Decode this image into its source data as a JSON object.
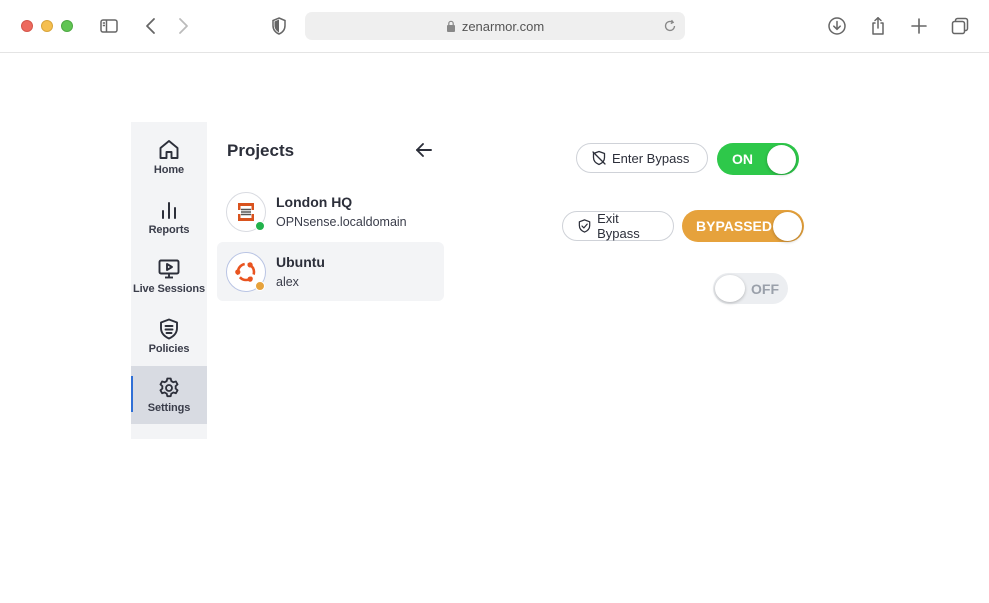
{
  "browser": {
    "url": "zenarmor.com",
    "colors": {
      "red": "#ed6a5e",
      "yellow": "#f5bf4f",
      "green": "#61c554"
    },
    "icons": [
      "sidebar-toggle-icon",
      "back-icon",
      "forward-icon",
      "shield-icon",
      "lock-icon",
      "reload-icon",
      "download-icon",
      "share-icon",
      "new-tab-icon",
      "tabs-overview-icon"
    ]
  },
  "sidebar": {
    "items": [
      {
        "label": "Home",
        "icon": "home-icon"
      },
      {
        "label": "Reports",
        "icon": "bar-chart-icon"
      },
      {
        "label": "Live Sessions",
        "icon": "monitor-play-icon"
      },
      {
        "label": "Policies",
        "icon": "policy-shield-icon"
      },
      {
        "label": "Settings",
        "icon": "gear-icon",
        "active": true
      }
    ]
  },
  "projects": {
    "title": "Projects",
    "items": [
      {
        "name": "London HQ",
        "subtitle": "OPNsense.localdomain",
        "status_color": "#22b24c",
        "selected": false
      },
      {
        "name": "Ubuntu",
        "subtitle": "alex",
        "status_color": "#e6a23c",
        "selected": true
      }
    ]
  },
  "bypass": {
    "enter_label": "Enter Bypass",
    "exit_label": "Exit Bypass",
    "toggle_on_label": "ON",
    "toggle_bypassed_label": "BYPASSED",
    "toggle_off_label": "OFF",
    "colors": {
      "on": "#2ec84a",
      "bypassed": "#e6a23c",
      "off": "#eceef1"
    }
  }
}
